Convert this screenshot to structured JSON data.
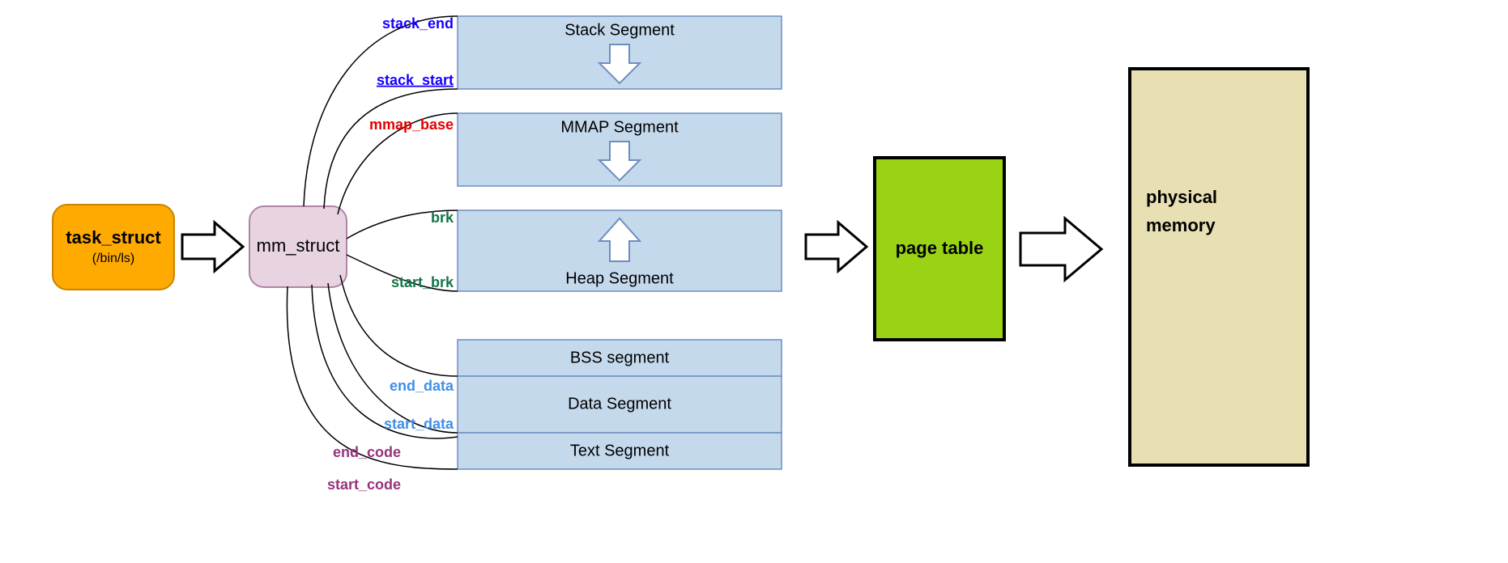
{
  "task_struct": {
    "title": "task_struct",
    "subtitle": "(/bin/ls)"
  },
  "mm_struct": {
    "title": "mm_struct"
  },
  "page_table": {
    "title": "page table"
  },
  "physical_memory": {
    "line1": "physical",
    "line2": "memory"
  },
  "segments": {
    "stack": "Stack Segment",
    "mmap": "MMAP Segment",
    "heap": "Heap Segment",
    "bss": "BSS segment",
    "data": "Data Segment",
    "text": "Text Segment"
  },
  "pointers": {
    "stack_end": {
      "text": "stack_end",
      "color": "#1600FF"
    },
    "stack_start": {
      "text": "stack_start",
      "color": "#1600FF"
    },
    "mmap_base": {
      "text": "mmap_base",
      "color": "#E30000"
    },
    "brk": {
      "text": "brk",
      "color": "#147447"
    },
    "start_brk": {
      "text": "start_brk",
      "color": "#147447"
    },
    "end_data": {
      "text": "end_data",
      "color": "#3F8FE8"
    },
    "start_data": {
      "text": "start_data",
      "color": "#3F8FE8"
    },
    "end_code": {
      "text": "end_code",
      "color": "#96337B"
    },
    "start_code": {
      "text": "start_code",
      "color": "#96337B"
    }
  }
}
